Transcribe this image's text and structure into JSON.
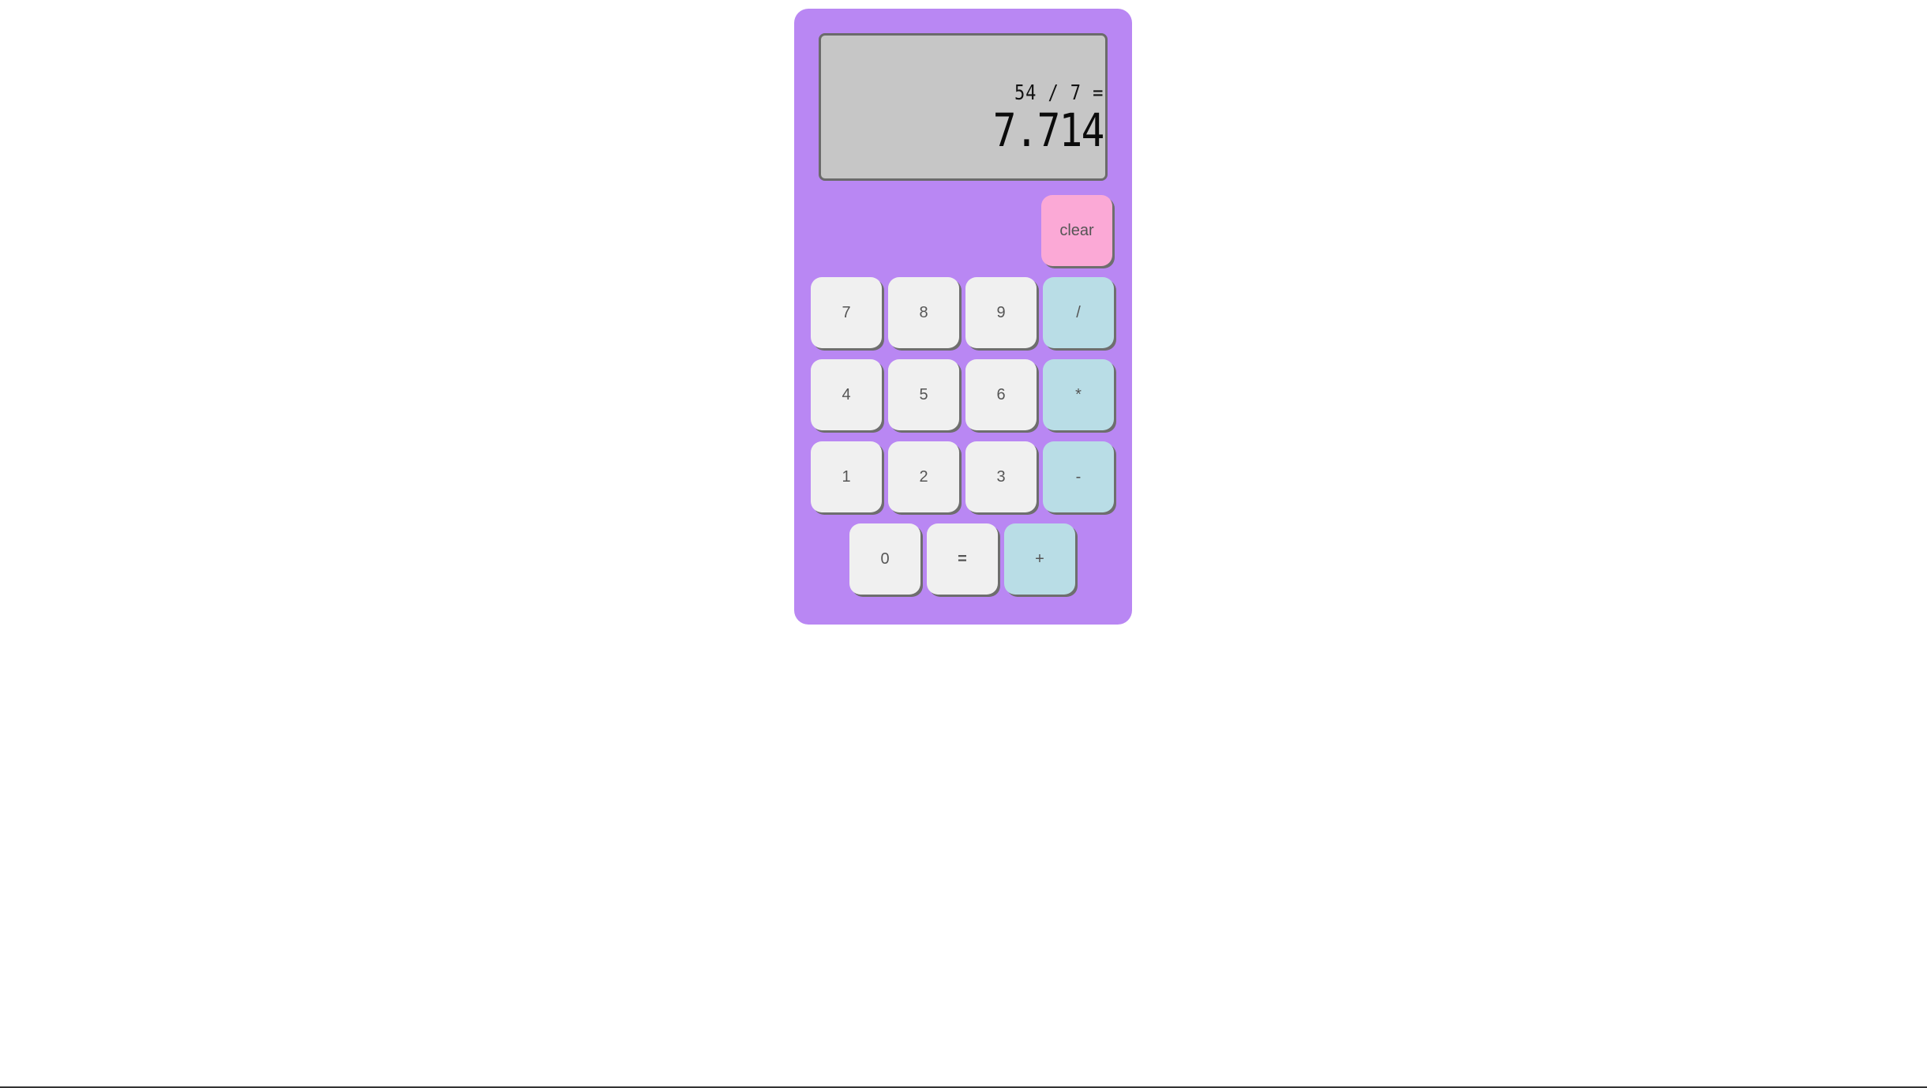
{
  "display": {
    "expression": "54 / 7 =",
    "result": "7.714"
  },
  "keys": {
    "clear": "clear",
    "k7": "7",
    "k8": "8",
    "k9": "9",
    "divide": "/",
    "k4": "4",
    "k5": "5",
    "k6": "6",
    "multiply": "*",
    "k1": "1",
    "k2": "2",
    "k3": "3",
    "subtract": "-",
    "k0": "0",
    "equals": "=",
    "add": "+"
  },
  "colors": {
    "body": "#b987f3",
    "display": "#c6c6c6",
    "number_key": "#f0f0f0",
    "operator_key": "#b9dde6",
    "clear_key": "#fba9d6"
  }
}
